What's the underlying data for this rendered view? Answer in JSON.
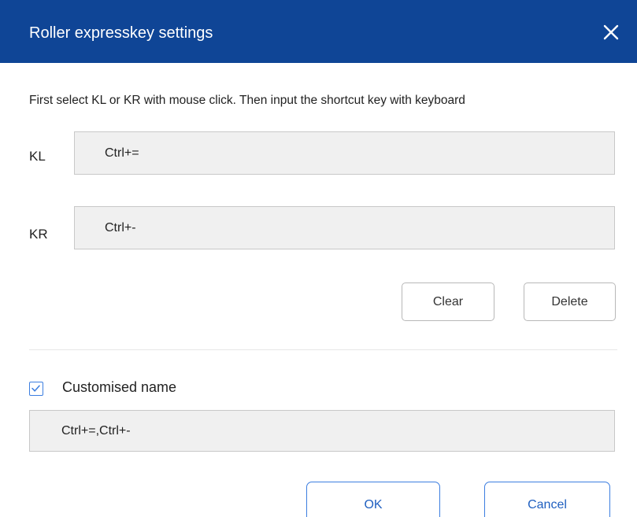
{
  "dialog": {
    "title": "Roller expresskey settings",
    "close_icon": "close-icon"
  },
  "instruction": "First select KL or KR with mouse click. Then input the shortcut key with keyboard",
  "keys": {
    "kl_label": "KL",
    "kl_value": "Ctrl+=",
    "kr_label": "KR",
    "kr_value": "Ctrl+-"
  },
  "actions": {
    "clear_label": "Clear",
    "delete_label": "Delete"
  },
  "custom_name": {
    "checked": true,
    "label": "Customised name",
    "value": "Ctrl+=,Ctrl+-"
  },
  "footer": {
    "ok_label": "OK",
    "cancel_label": "Cancel"
  },
  "colors": {
    "titlebar": "#0f4596",
    "accent": "#3c7ee0",
    "field_bg": "#f0f0f0"
  }
}
